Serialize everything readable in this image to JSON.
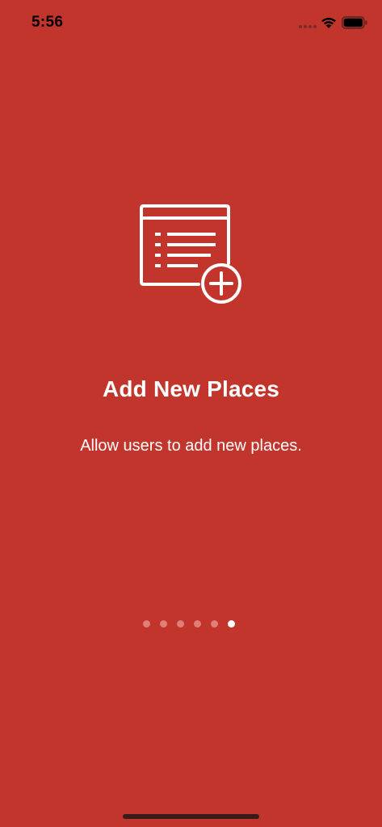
{
  "colors": {
    "background": "#c1352d",
    "foreground": "#ffffff",
    "status_bar_text": "#000000",
    "dot_inactive": "#e07e78",
    "dot_active": "#ffffff",
    "home_indicator": "#3a1a18"
  },
  "status_bar": {
    "time": "5:56",
    "signal_icon": "cellular-signal-icon",
    "wifi_icon": "wifi-icon",
    "battery_icon": "battery-icon"
  },
  "onboarding": {
    "icon": "list-add-icon",
    "title": "Add New Places",
    "subtitle": "Allow users to add new places."
  },
  "page_indicator": {
    "total_pages": 6,
    "current_page": 6
  }
}
